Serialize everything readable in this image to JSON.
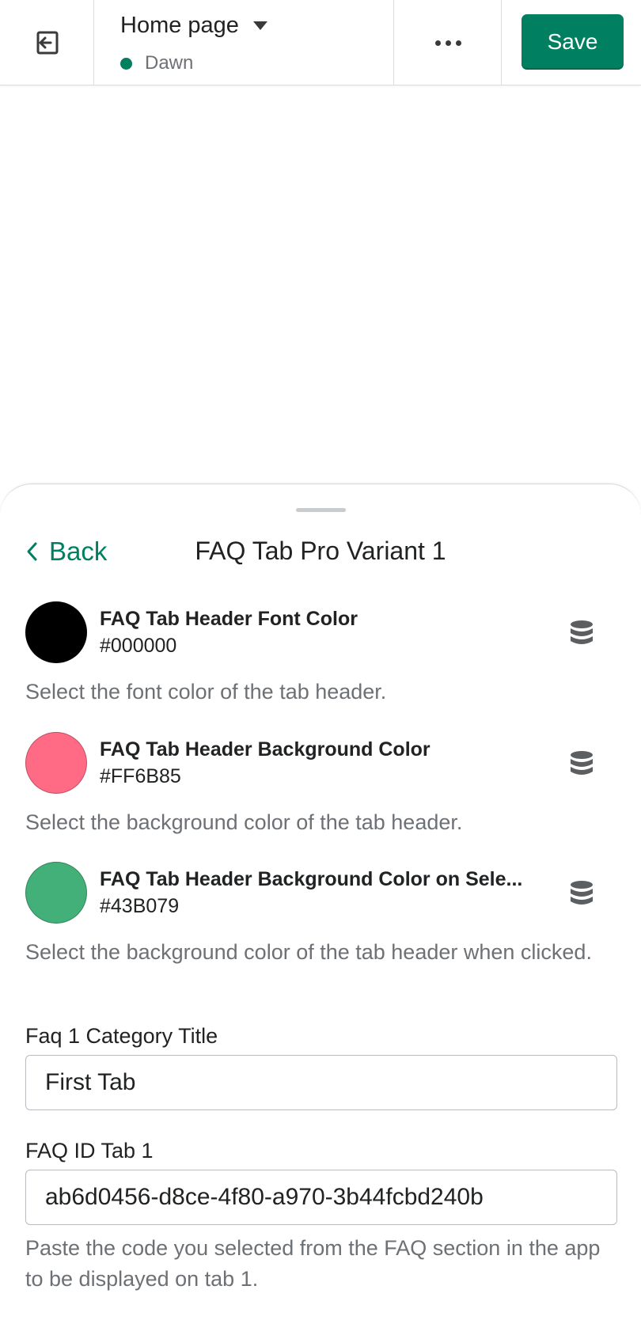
{
  "topbar": {
    "page_title": "Home page",
    "theme_name": "Dawn",
    "save_label": "Save",
    "status_color": "#008060"
  },
  "sheet": {
    "back_label": "Back",
    "title": "FAQ Tab Pro Variant 1",
    "color_settings": [
      {
        "label": "FAQ Tab Header Font Color",
        "value": "#000000",
        "help": "Select the font color of the tab header."
      },
      {
        "label": "FAQ Tab Header Background Color",
        "value": "#FF6B85",
        "help": "Select the background color of the tab header."
      },
      {
        "label": "FAQ Tab Header Background Color on Sele...",
        "value": "#43B079",
        "help": "Select the background color of the tab header when clicked."
      }
    ],
    "category_title": {
      "label": "Faq 1 Category Title",
      "value": "First Tab"
    },
    "faq_id": {
      "label": "FAQ ID Tab 1",
      "value": "ab6d0456-d8ce-4f80-a970-3b44fcbd240b",
      "help": "Paste the code you selected from the FAQ section in the app to be displayed on tab 1."
    }
  },
  "icons": {
    "exit": "exit-icon",
    "caret": "caret-down-icon",
    "more": "more-horizontal-icon",
    "back": "chevron-left-icon",
    "dynamic_source": "database-icon"
  },
  "colors": {
    "accent": "#008060",
    "muted_text": "#6d7175"
  }
}
